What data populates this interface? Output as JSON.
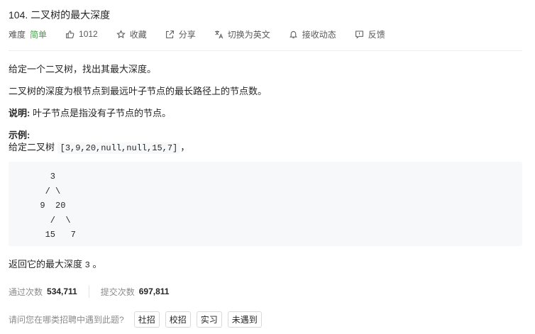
{
  "problem": {
    "title": "104. 二叉树的最大深度"
  },
  "meta": {
    "difficulty_label": "难度",
    "difficulty": "简单",
    "likes": "1012",
    "favorite": "收藏",
    "share": "分享",
    "switch_lang": "切换为英文",
    "notify": "接收动态",
    "feedback": "反馈",
    "colors": {
      "difficulty": "#43a047",
      "code_bg": "#f7f8fa"
    },
    "icons": [
      "thumbs-up-icon",
      "star-icon",
      "share-icon",
      "translate-icon",
      "bell-icon",
      "feedback-icon"
    ]
  },
  "description": {
    "p1": "给定一个二叉树，找出其最大深度。",
    "p2": "二叉树的深度为根节点到最远叶子节点的最长路径上的节点数。",
    "note_label": "说明:",
    "note_text": " 叶子节点是指没有子节点的节点。",
    "example_label": "示例:",
    "example_prefix": "给定二叉树 ",
    "example_code": "[3,9,20,null,null,15,7]",
    "example_suffix": "，",
    "tree": "    3\n   / \\\n  9  20\n    /  \\\n   15   7",
    "result_prefix": "返回它的最大深度 ",
    "result_code": "3",
    "result_suffix": " 。"
  },
  "stats": {
    "accepted_label": "通过次数",
    "accepted": "534,711",
    "submitted_label": "提交次数",
    "submitted": "697,811"
  },
  "interview": {
    "question": "请问您在哪类招聘中遇到此题?",
    "options": [
      "社招",
      "校招",
      "实习",
      "未遇到"
    ]
  }
}
